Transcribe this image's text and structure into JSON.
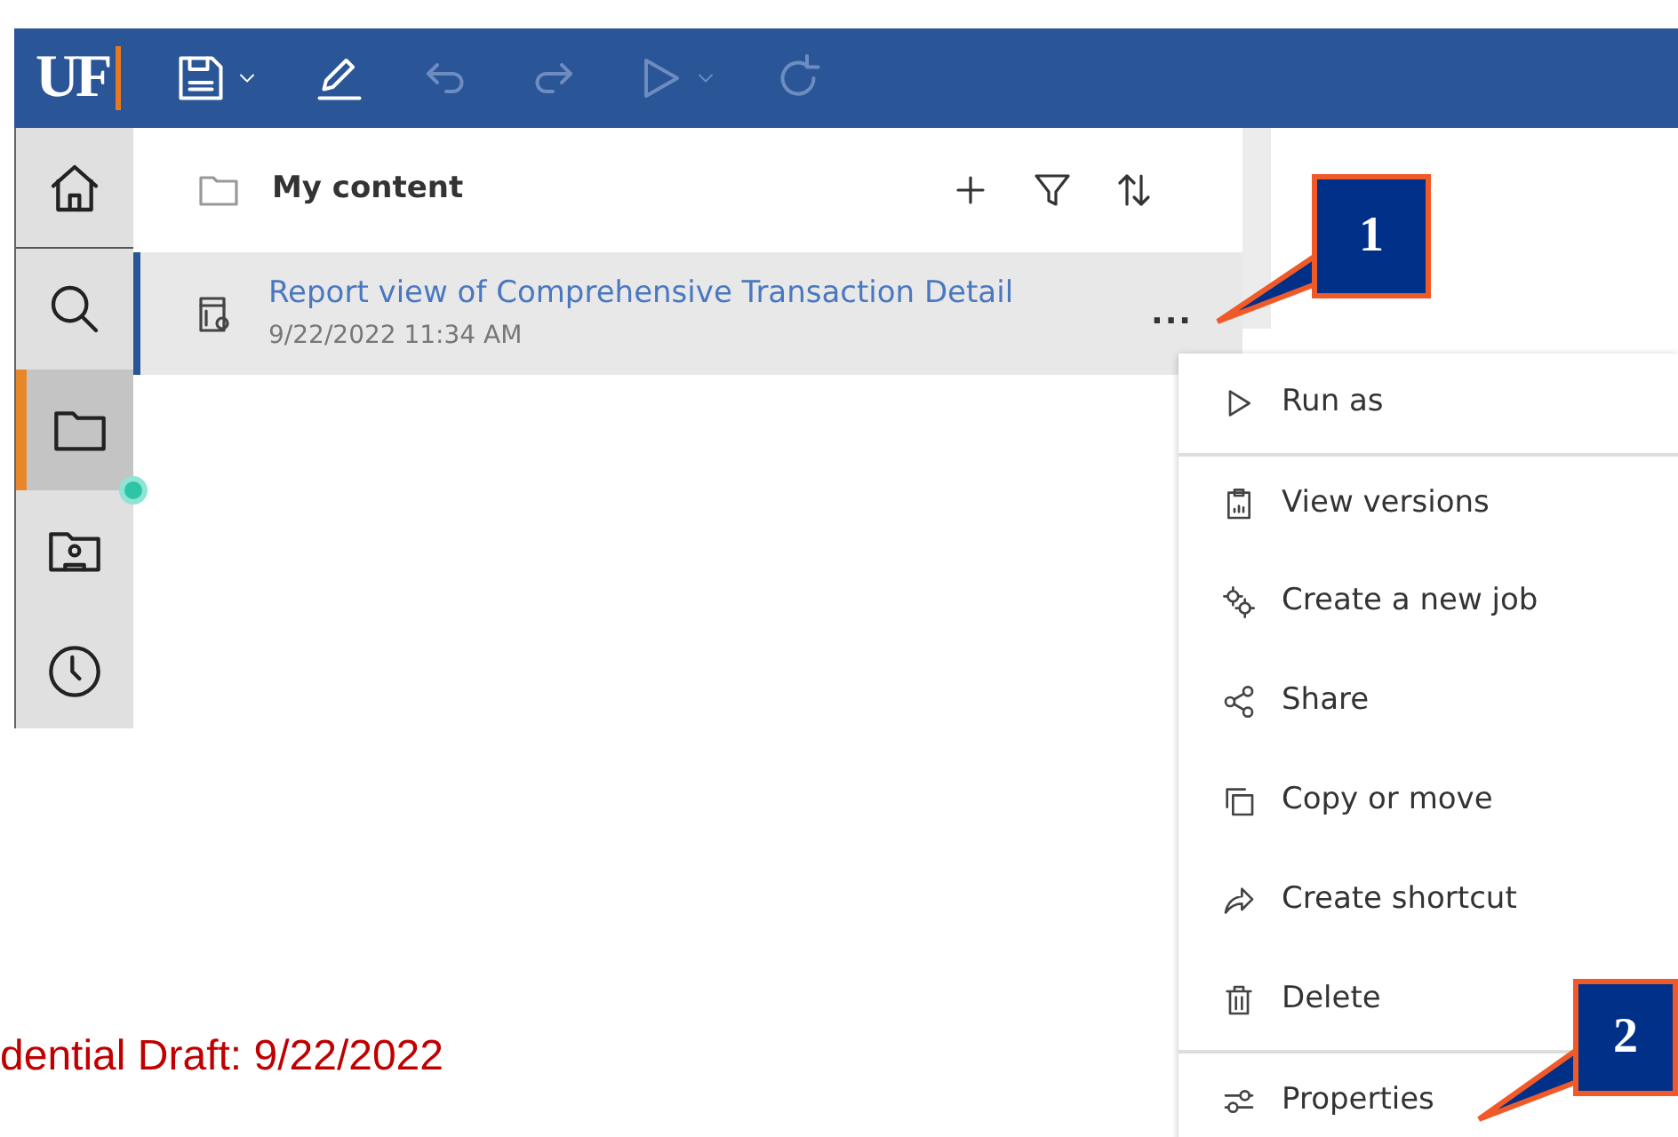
{
  "toolbar": {
    "logo": "UF",
    "buttons": [
      {
        "kind": "save",
        "dropdown": true,
        "disabled": false
      },
      {
        "kind": "edit",
        "dropdown": false,
        "disabled": false
      },
      {
        "kind": "undo",
        "dropdown": false,
        "disabled": true
      },
      {
        "kind": "redo",
        "dropdown": false,
        "disabled": true
      },
      {
        "kind": "run",
        "dropdown": true,
        "disabled": true
      },
      {
        "kind": "refresh",
        "dropdown": false,
        "disabled": true
      }
    ]
  },
  "sidebar": {
    "items": [
      {
        "kind": "home",
        "selected": false,
        "notification": false
      },
      {
        "kind": "search",
        "selected": false,
        "notification": false
      },
      {
        "kind": "content",
        "selected": true,
        "notification": true
      },
      {
        "kind": "team",
        "selected": false,
        "notification": false
      },
      {
        "kind": "recent",
        "selected": false,
        "notification": false
      }
    ]
  },
  "content": {
    "title": "My content",
    "actions": [
      {
        "kind": "add"
      },
      {
        "kind": "filter"
      },
      {
        "kind": "sort"
      }
    ],
    "items": [
      {
        "title": "Report view of Comprehensive Transaction Detail",
        "date": "9/22/2022 11:34 AM",
        "selected": true,
        "more": "..."
      }
    ]
  },
  "menu": {
    "items": [
      {
        "kind": "run",
        "label": "Run as",
        "divider_before": false
      },
      {
        "kind": "versions",
        "label": "View versions",
        "divider_before": true
      },
      {
        "kind": "job",
        "label": "Create a new job",
        "divider_before": false
      },
      {
        "kind": "share",
        "label": "Share",
        "divider_before": false
      },
      {
        "kind": "copy",
        "label": "Copy or move",
        "divider_before": false
      },
      {
        "kind": "shortcut",
        "label": "Create shortcut",
        "divider_before": false
      },
      {
        "kind": "delete",
        "label": "Delete",
        "divider_before": false
      },
      {
        "kind": "properties",
        "label": "Properties",
        "divider_before": true
      }
    ]
  },
  "draft_note": "dential Draft:  9/22/2022",
  "callouts": [
    {
      "label": "1"
    },
    {
      "label": "2"
    }
  ]
}
